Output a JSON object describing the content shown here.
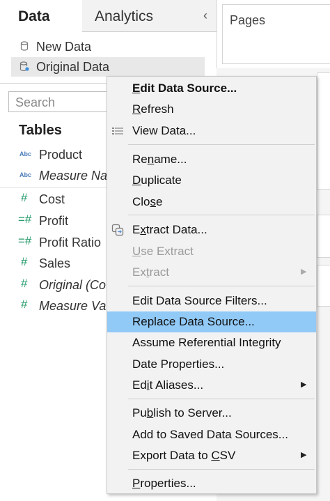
{
  "tabs": {
    "data_label": "Data",
    "analytics_label": "Analytics",
    "collapse_glyph": "‹"
  },
  "data_sources": [
    {
      "label": "New Data",
      "icon": "database-icon"
    },
    {
      "label": "Original Data",
      "icon": "database-active-icon"
    }
  ],
  "search": {
    "placeholder": "Search"
  },
  "tables_heading": "Tables",
  "fields": [
    {
      "type_glyph": "Abc",
      "label": "Product"
    },
    {
      "type_glyph": "Abc",
      "label": "Measure Na"
    },
    {
      "type_glyph": "#",
      "label": "Cost"
    },
    {
      "type_glyph": "=#",
      "label": "Profit"
    },
    {
      "type_glyph": "=#",
      "label": "Profit Ratio"
    },
    {
      "type_glyph": "#",
      "label": "Sales"
    },
    {
      "type_glyph": "#",
      "label": "Original (Co"
    },
    {
      "type_glyph": "#",
      "label": "Measure Va"
    }
  ],
  "pages_card": {
    "title": "Pages"
  },
  "menu": {
    "items": [
      {
        "label": "Edit Data Source...",
        "mnemonic": "E"
      },
      {
        "label": "Refresh",
        "mnemonic": "R"
      },
      {
        "label": "View Data...",
        "mnemonic": ""
      },
      {
        "label": "Rename...",
        "mnemonic": "n"
      },
      {
        "label": "Duplicate",
        "mnemonic": "D"
      },
      {
        "label": "Close",
        "mnemonic": "s"
      },
      {
        "label": "Extract Data...",
        "mnemonic": "x"
      },
      {
        "label": "Use Extract",
        "mnemonic": "U"
      },
      {
        "label": "Extract",
        "mnemonic": "t"
      },
      {
        "label": "Edit Data Source Filters...",
        "mnemonic": ""
      },
      {
        "label": "Replace Data Source...",
        "mnemonic": ""
      },
      {
        "label": "Assume Referential Integrity",
        "mnemonic": ""
      },
      {
        "label": "Date Properties...",
        "mnemonic": ""
      },
      {
        "label": "Edit Aliases...",
        "mnemonic": "i"
      },
      {
        "label": "Publish to Server...",
        "mnemonic": "b"
      },
      {
        "label": "Add to Saved Data Sources...",
        "mnemonic": ""
      },
      {
        "label": "Export Data to CSV",
        "mnemonic": "C"
      },
      {
        "label": "Properties...",
        "mnemonic": "P"
      }
    ],
    "submenu_glyph": "▶",
    "highlight_color": "#91c9f7"
  },
  "colors": {
    "dimension_icon": "#4a7bb8",
    "measure_icon": "#2a9d6e"
  }
}
